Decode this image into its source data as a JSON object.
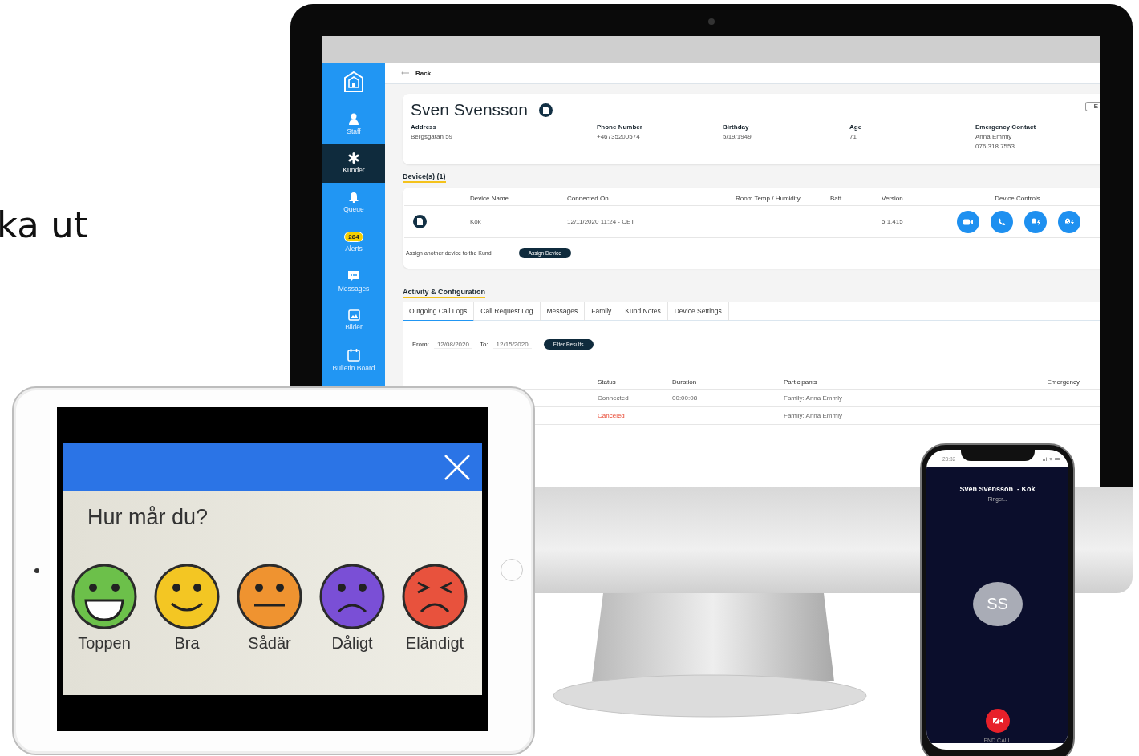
{
  "caption": "ka ut",
  "monitor": {
    "sidebar": [
      {
        "label": "Staff",
        "kind": "person",
        "selected": false
      },
      {
        "label": "Kunder",
        "kind": "asterisk",
        "selected": true
      },
      {
        "label": "Queue",
        "kind": "bell",
        "selected": false
      },
      {
        "label": "Alerts",
        "kind": "badge",
        "badge": "284",
        "selected": false
      },
      {
        "label": "Messages",
        "kind": "chat",
        "selected": false
      },
      {
        "label": "Bilder",
        "kind": "image",
        "selected": false
      },
      {
        "label": "Bulletin Board",
        "kind": "calendar",
        "selected": false
      }
    ],
    "back": "Back",
    "customer": {
      "name": "Sven Svensson",
      "edit_button": "E",
      "fields": [
        {
          "label": "Address",
          "lines": [
            "Bergsgatan 59"
          ]
        },
        {
          "label": "Phone Number",
          "lines": [
            "+46735200574"
          ]
        },
        {
          "label": "Birthday",
          "lines": [
            "5/19/1949"
          ]
        },
        {
          "label": "Age",
          "lines": [
            "71"
          ]
        },
        {
          "label": "Emergency Contact",
          "lines": [
            "Anna Emmly",
            "076 318 7553"
          ]
        }
      ]
    },
    "devices": {
      "title": "Device(s) (1)",
      "columns": [
        "Device Name",
        "Connected On",
        "Room Temp / Humidity",
        "Batt.",
        "Version",
        "Device Controls"
      ],
      "rows": [
        {
          "name": "Kök",
          "connected": "12/11/2020 11:24 - CET",
          "version": "5.1.415",
          "controls": [
            {
              "kind": "video"
            },
            {
              "kind": "phone"
            },
            {
              "kind": "bell-bolt"
            },
            {
              "kind": "bell-off-bolt"
            }
          ]
        }
      ],
      "assign_text": "Assign another device to the Kund",
      "assign_button": "Assign Device"
    },
    "activity": {
      "title": "Activity & Configuration",
      "tabs": [
        {
          "label": "Outgoing Call Logs",
          "selected": true
        },
        {
          "label": "Call Request Log",
          "selected": false
        },
        {
          "label": "Messages",
          "selected": false
        },
        {
          "label": "Family",
          "selected": false
        },
        {
          "label": "Kund Notes",
          "selected": false
        },
        {
          "label": "Device Settings",
          "selected": false
        }
      ],
      "from_label": "From:",
      "from": "12/08/2020",
      "to_label": "To:",
      "to": "12/15/2020",
      "filter_button": "Filter Results",
      "columns": [
        "Status",
        "Duration",
        "Participants",
        "Emergency"
      ],
      "rows": [
        {
          "status": "Connected",
          "kind": "ok",
          "duration": "00:00:08",
          "participants": "Family: Anna Emmly"
        },
        {
          "status": "Canceled",
          "kind": "canceled",
          "duration": "",
          "participants": "Family: Anna Emmly"
        }
      ]
    }
  },
  "tablet": {
    "question": "Hur mår du?",
    "options": [
      {
        "label": "Toppen",
        "kind": "great",
        "color": "#6cc04a"
      },
      {
        "label": "Bra",
        "kind": "good",
        "color": "#f3c623"
      },
      {
        "label": "Sådär",
        "kind": "neutral",
        "color": "#ef9330"
      },
      {
        "label": "Dåligt",
        "kind": "sad",
        "color": "#7a4fd6"
      },
      {
        "label": "Eländigt",
        "kind": "awful",
        "color": "#e8523d"
      }
    ]
  },
  "phone": {
    "time": "23:32",
    "caller": "Sven Svensson  - Kök",
    "status": "Ringer...",
    "initials": "SS",
    "end_call": "END CALL"
  }
}
